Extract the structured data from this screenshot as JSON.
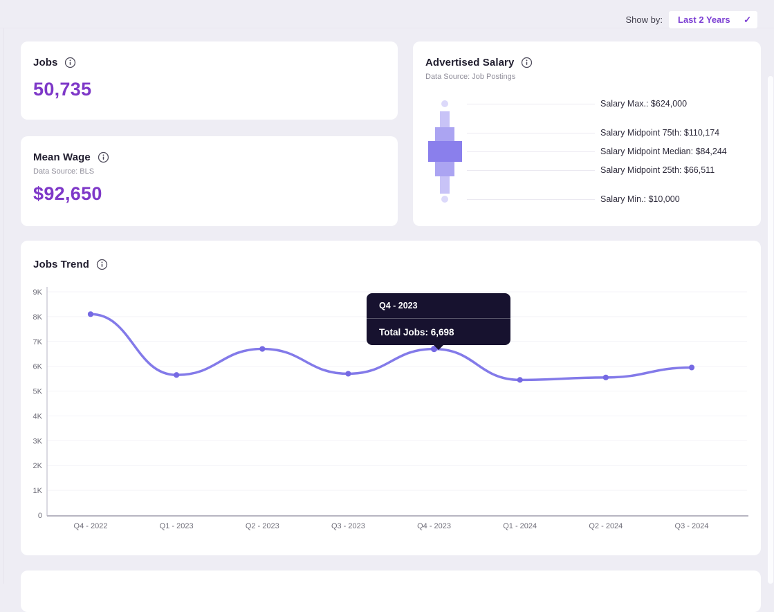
{
  "colors": {
    "page_bg": "#EEEDF4",
    "accent_purple": "#7E38C8",
    "dropdown_purple": "#7C3FD3",
    "line_color": "#837AE9",
    "point_color": "#7569E3",
    "tooltip_bg": "#17122F",
    "gridline": "#F4F3F8",
    "box_dark": "#8A7FEC",
    "box_mid": "#ABA4F2",
    "box_light": "#C8C3F7",
    "box_dot": "#DCD9FA"
  },
  "header": {
    "show_by_label": "Show by:",
    "filter_value": "Last 2 Years",
    "filter_check_glyph": "✓"
  },
  "jobs_card": {
    "title": "Jobs",
    "value": "50,735"
  },
  "mean_wage_card": {
    "title": "Mean Wage",
    "data_source": "Data Source: BLS",
    "value": "$92,650"
  },
  "advertised_salary_card": {
    "title": "Advertised Salary",
    "data_source": "Data Source: Job Postings",
    "stats": [
      {
        "text": "Salary Max.: $624,000"
      },
      {
        "text": "Salary Midpoint 75th: $110,174"
      },
      {
        "text": "Salary Midpoint Median: $84,244"
      },
      {
        "text": "Salary Midpoint 25th: $66,511"
      },
      {
        "text": "Salary Min.: $10,000"
      }
    ]
  },
  "jobs_trend_card": {
    "title": "Jobs Trend",
    "tooltip": {
      "title": "Q4 - 2023",
      "text": "Total Jobs: 6,698"
    }
  },
  "chart_data": [
    {
      "type": "boxplot",
      "title": "Advertised Salary",
      "orientation": "vertical",
      "unit": "USD",
      "values": {
        "max": 624000,
        "p75": 110174,
        "median": 84244,
        "p25": 66511,
        "min": 10000
      }
    },
    {
      "type": "line",
      "title": "Jobs Trend",
      "categories": [
        "Q4 - 2022",
        "Q1 - 2023",
        "Q2 - 2023",
        "Q3 - 2023",
        "Q4 - 2023",
        "Q1 - 2024",
        "Q2 - 2024",
        "Q3 - 2024"
      ],
      "series": [
        {
          "name": "Total Jobs",
          "values": [
            8100,
            5650,
            6700,
            5700,
            6698,
            5450,
            5550,
            5950
          ]
        }
      ],
      "ylim": [
        0,
        9000
      ],
      "y_ticks": [
        "0",
        "1K",
        "2K",
        "3K",
        "4K",
        "5K",
        "6K",
        "7K",
        "8K",
        "9K"
      ],
      "grid": true,
      "legend": "none",
      "highlighted_point": {
        "category": "Q4 - 2023",
        "value": 6698
      }
    }
  ]
}
